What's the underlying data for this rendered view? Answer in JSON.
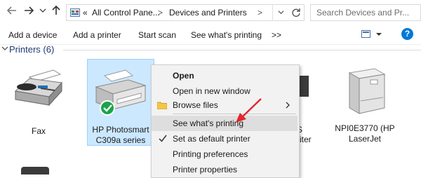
{
  "address_bar": {
    "back_icon": "back-arrow-icon",
    "forward_icon": "forward-arrow-icon",
    "dropdown_icon": "chevron-down-icon",
    "up_icon": "up-arrow-icon",
    "overflow": "«",
    "path": [
      "All Control Pane...",
      "Devices and Printers"
    ],
    "separator": ">"
  },
  "search": {
    "placeholder": "Search Devices and Pr..."
  },
  "toolbar": {
    "items": [
      "Add a device",
      "Add a printer",
      "Start scan",
      "See what's printing",
      ">>"
    ],
    "view_icon": "view-options-icon",
    "help_icon": "help-icon",
    "help_symbol": "?"
  },
  "group": {
    "label": "Printers (6)"
  },
  "devices": [
    {
      "name": "Fax",
      "icon": "fax-icon"
    },
    {
      "name": "HP Photosmart C309a series",
      "line1": "HP Photosmart",
      "line2": "C309a series",
      "icon": "printer-icon",
      "default": true
    },
    {
      "name": "NPI0E3770 (HP LaserJet ...",
      "line1": "NPI0E3770 (HP",
      "line2": "LaserJet",
      "icon": "laser-printer-icon"
    }
  ],
  "partial_labels": [
    "S",
    "riter"
  ],
  "context_menu": {
    "items": [
      {
        "label": "Open",
        "bold": true
      },
      {
        "label": "Open in new window"
      },
      {
        "label": "Browse files",
        "icon": "folder-icon",
        "submenu": true
      },
      {
        "label": "See what's printing",
        "highlighted": true
      },
      {
        "label": "Set as default printer",
        "icon": "checkmark-icon"
      },
      {
        "label": "Printing preferences"
      },
      {
        "label": "Printer properties"
      }
    ]
  },
  "colors": {
    "accent": "#0078d7",
    "selection": "#cce8ff",
    "annotation_arrow": "#e0262e",
    "default_badge": "#1aa34a"
  }
}
